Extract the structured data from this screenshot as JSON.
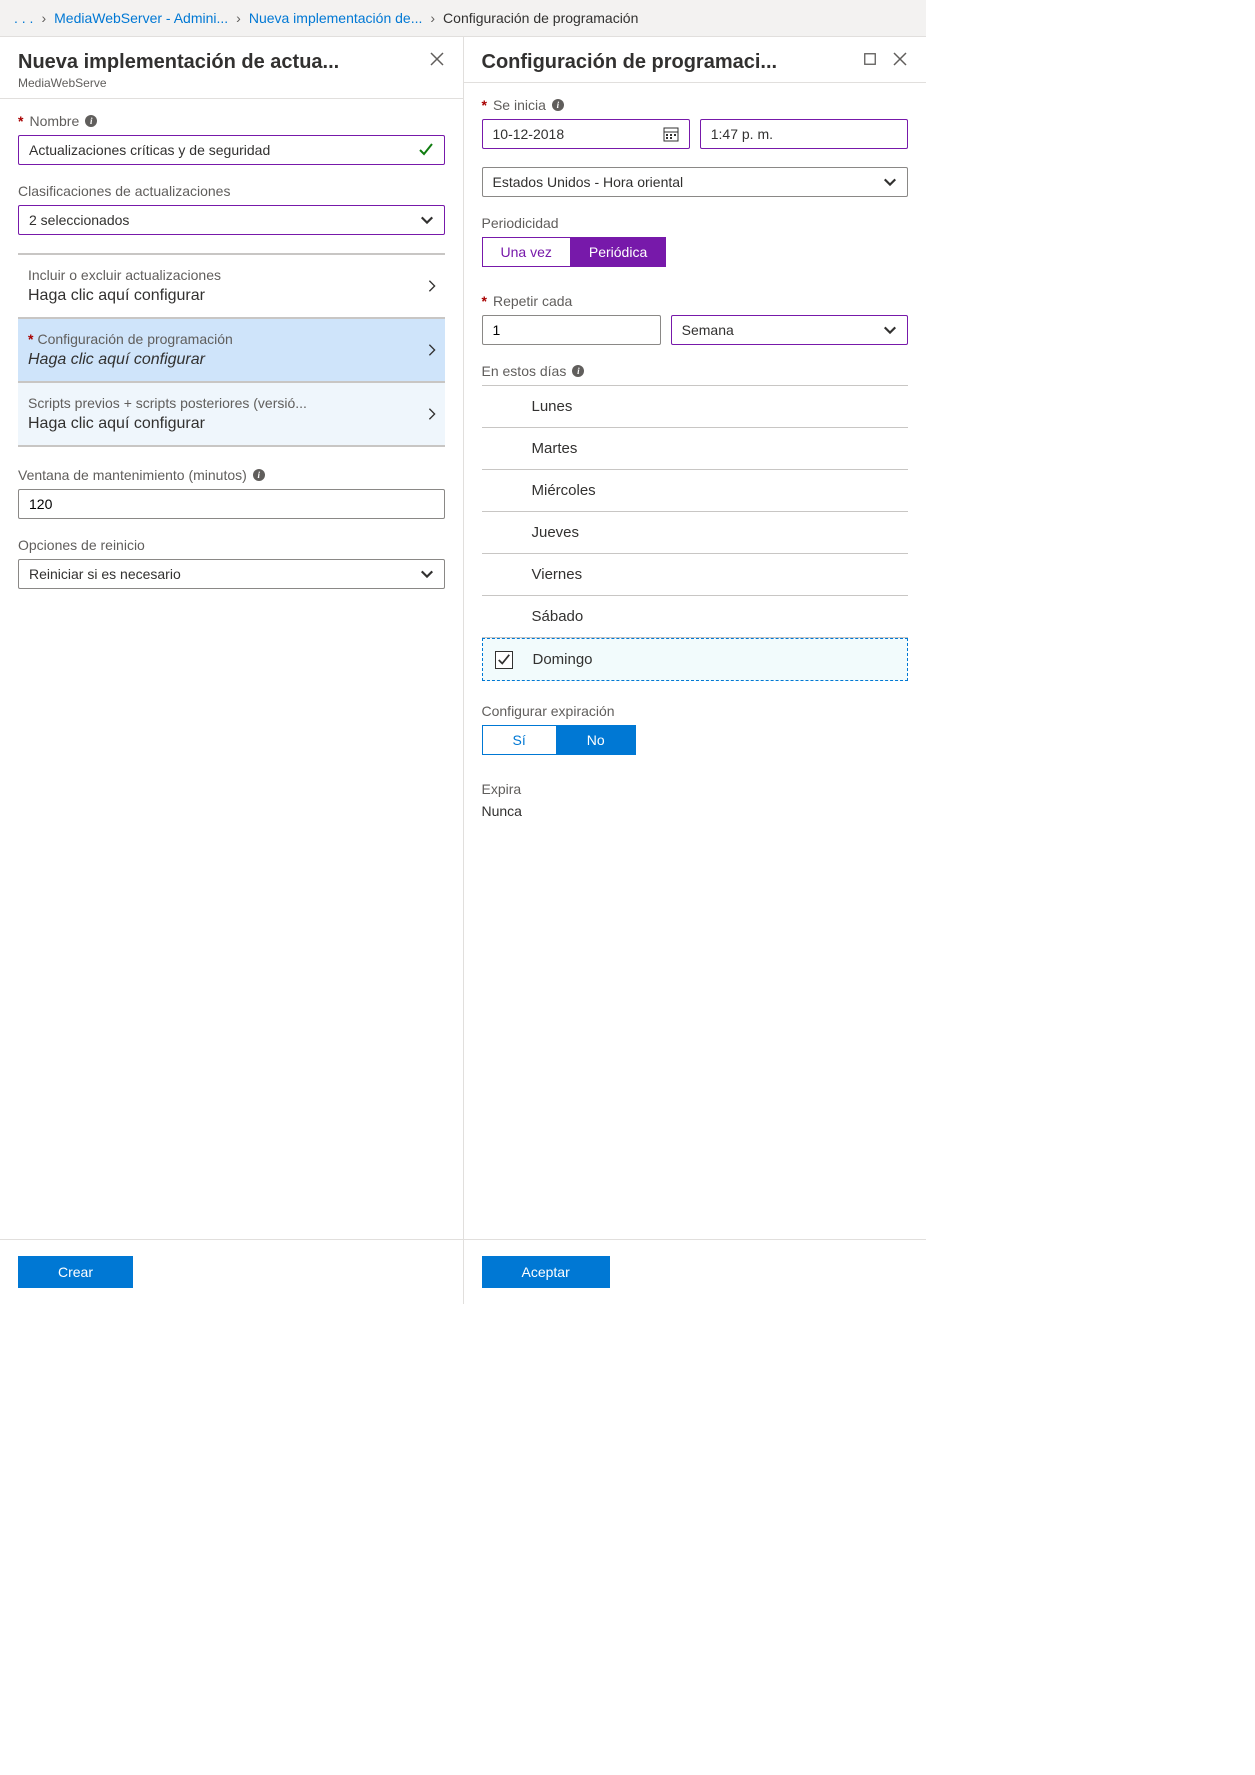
{
  "breadcrumb": {
    "ellipsis": ". . .",
    "item1": "MediaWebServer - Admini...",
    "item2": "Nueva implementación de...",
    "item3": "Configuración de programación"
  },
  "left": {
    "title": "Nueva implementación de actua...",
    "subtitle": "MediaWebServe",
    "name_label": "Nombre",
    "name_value": "Actualizaciones críticas y de seguridad",
    "classifications_label": "Clasificaciones de actualizaciones",
    "classifications_value": "2 seleccionados",
    "include_title": "Incluir o excluir actualizaciones",
    "include_sub": "Haga clic aquí configurar",
    "schedule_title": "Configuración de programación",
    "schedule_sub": "Haga clic aquí configurar",
    "scripts_title": "Scripts previos + scripts posteriores (versió...",
    "scripts_sub": "Haga clic aquí configurar",
    "maint_label": "Ventana de mantenimiento (minutos)",
    "maint_value": "120",
    "reboot_label": "Opciones de reinicio",
    "reboot_value": "Reiniciar si es necesario",
    "create_btn": "Crear"
  },
  "right": {
    "title": "Configuración de programaci...",
    "start_label": "Se inicia",
    "start_date": "10-12-2018",
    "start_time": "1:47 p. m.",
    "tz_value": "Estados Unidos - Hora oriental",
    "period_label": "Periodicidad",
    "once": "Una vez",
    "recurring": "Periódica",
    "repeat_label": "Repetir cada",
    "repeat_value": "1",
    "repeat_unit": "Semana",
    "days_label": "En estos días",
    "days": {
      "d0": "Lunes",
      "d1": "Martes",
      "d2": "Miércoles",
      "d3": "Jueves",
      "d4": "Viernes",
      "d5": "Sábado",
      "d6": "Domingo"
    },
    "expire_label": "Configurar expiración",
    "yes": "Sí",
    "no": "No",
    "expires_label": "Expira",
    "expires_value": "Nunca",
    "accept_btn": "Aceptar"
  }
}
